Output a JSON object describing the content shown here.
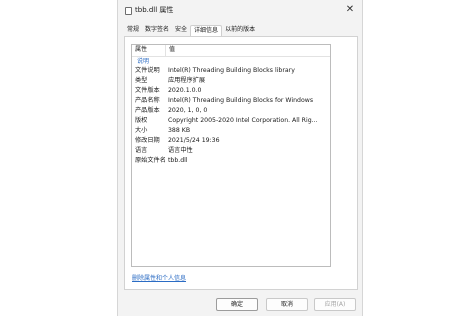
{
  "window": {
    "title": "tbb.dll 属性",
    "close_glyph": "✕"
  },
  "tabs": [
    {
      "label": "常规",
      "active": false
    },
    {
      "label": "数字签名",
      "active": false
    },
    {
      "label": "安全",
      "active": false
    },
    {
      "label": "详细信息",
      "active": true
    },
    {
      "label": "以前的版本",
      "active": false
    }
  ],
  "details": {
    "header": {
      "property": "属性",
      "value": "值"
    },
    "group": "说明",
    "rows": [
      {
        "key": "文件说明",
        "value": "Intel(R) Threading Building Blocks library"
      },
      {
        "key": "类型",
        "value": "应用程序扩展"
      },
      {
        "key": "文件版本",
        "value": "2020.1.0.0"
      },
      {
        "key": "产品名称",
        "value": "Intel(R) Threading Building Blocks for Windows"
      },
      {
        "key": "产品版本",
        "value": "2020, 1, 0, 0"
      },
      {
        "key": "版权",
        "value": "Copyright 2005-2020 Intel Corporation.  All Rig..."
      },
      {
        "key": "大小",
        "value": "388 KB"
      },
      {
        "key": "修改日期",
        "value": "2021/5/24 19:36"
      },
      {
        "key": "语言",
        "value": "语言中性"
      },
      {
        "key": "原始文件名",
        "value": "tbb.dll"
      }
    ]
  },
  "remove_link": "删除属性和个人信息",
  "buttons": {
    "ok": "确定",
    "cancel": "取消",
    "apply": "应用(A)"
  }
}
